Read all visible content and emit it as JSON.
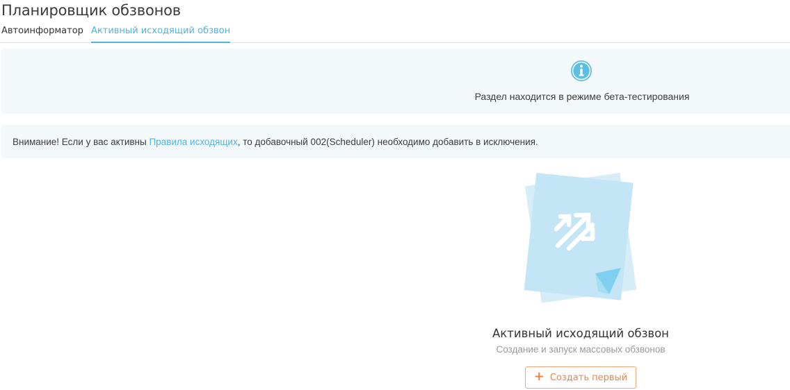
{
  "header": {
    "title": "Планировщик обзвонов"
  },
  "tabs": [
    {
      "label": "Автоинформатор",
      "active": false
    },
    {
      "label": "Активный исходящий обзвон",
      "active": true
    }
  ],
  "beta_banner": {
    "icon": "info-icon",
    "text": "Раздел находится в режиме бета-тестирования"
  },
  "warning": {
    "prefix": "Внимание! Если у вас активны ",
    "link_text": "Правила исходящих",
    "suffix": ", то добавочный 002(Scheduler) необходимо добавить в исключения."
  },
  "empty_state": {
    "illustration_icon": "outgoing-calls-document-icon",
    "title": "Активный исходящий обзвон",
    "subtitle": "Создание и запуск массовых обзвонов",
    "button_icon": "plus-icon",
    "button_label": "Создать первый"
  },
  "colors": {
    "accent_blue": "#4fb3d9",
    "accent_orange": "#e9854a",
    "banner_bg": "#f3f8fb"
  }
}
